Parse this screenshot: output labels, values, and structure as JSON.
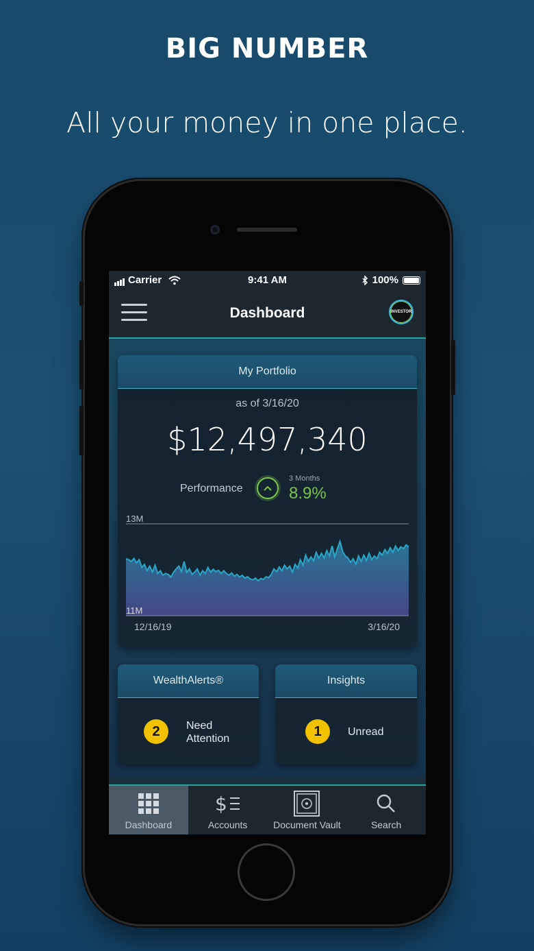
{
  "promo": {
    "headline": "BIG NUMBER",
    "subheadline": "All your money in one place."
  },
  "status_bar": {
    "carrier": "Carrier",
    "time": "9:41 AM",
    "battery": "100%"
  },
  "nav": {
    "title": "Dashboard",
    "logo_text": "INVESTOR"
  },
  "portfolio": {
    "title": "My Portfolio",
    "as_of": "as of 3/16/20",
    "total": "$12,497,340",
    "performance_label": "Performance",
    "performance_period": "3 Months",
    "performance_value": "8.9%"
  },
  "chart_data": {
    "type": "area",
    "ymax_label": "13M",
    "ymin_label": "11M",
    "x_start_label": "12/16/19",
    "x_end_label": "3/16/20",
    "ylim": [
      11,
      13
    ],
    "values": [
      12.24,
      12.22,
      12.18,
      12.25,
      12.15,
      12.22,
      12.05,
      12.12,
      11.98,
      12.08,
      11.95,
      12.1,
      11.92,
      11.98,
      11.88,
      11.92,
      11.9,
      11.84,
      11.95,
      12.02,
      12.08,
      11.96,
      12.18,
      11.94,
      12.02,
      11.9,
      11.95,
      12.02,
      11.88,
      11.98,
      11.92,
      12.05,
      11.95,
      12.01,
      11.96,
      11.99,
      11.92,
      11.98,
      11.92,
      11.88,
      11.93,
      11.86,
      11.9,
      11.84,
      11.88,
      11.82,
      11.85,
      11.8,
      11.78,
      11.82,
      11.76,
      11.81,
      11.79,
      11.85,
      11.83,
      11.9,
      12.02,
      11.96,
      12.06,
      11.98,
      12.1,
      12.02,
      12.08,
      11.95,
      12.12,
      12.04,
      12.22,
      12.1,
      12.32,
      12.18,
      12.28,
      12.2,
      12.38,
      12.25,
      12.36,
      12.26,
      12.42,
      12.3,
      12.52,
      12.28,
      12.46,
      12.62,
      12.4,
      12.3,
      12.26,
      12.16,
      12.24,
      12.12,
      12.3,
      12.18,
      12.32,
      12.2,
      12.36,
      12.22,
      12.3,
      12.24,
      12.38,
      12.32,
      12.44,
      12.36,
      12.48,
      12.38,
      12.52,
      12.42,
      12.5,
      12.46,
      12.54,
      12.5
    ]
  },
  "wealth_alerts": {
    "title": "WealthAlerts®",
    "count": "2",
    "line1": "Need",
    "line2": "Attention"
  },
  "insights": {
    "title": "Insights",
    "count": "1",
    "status": "Unread"
  },
  "tabs": [
    {
      "label": "Dashboard",
      "icon": "grid-icon"
    },
    {
      "label": "Accounts",
      "icon": "dollar-list-icon"
    },
    {
      "label": "Document Vault",
      "icon": "vault-icon"
    },
    {
      "label": "Search",
      "icon": "search-icon"
    }
  ]
}
